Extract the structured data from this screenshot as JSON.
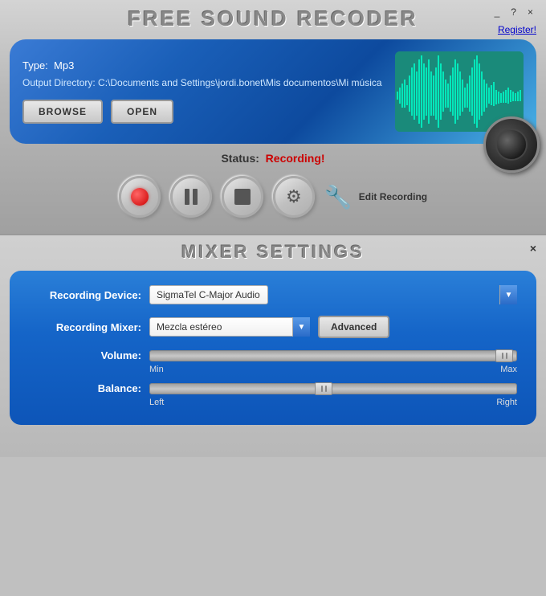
{
  "topWindow": {
    "title": "FREE SOUND RECODER",
    "controls": {
      "minimize": "_",
      "help": "?",
      "close": "×"
    },
    "registerLink": "Register!",
    "infoPanel": {
      "typeLabel": "Type:",
      "typeValue": "Mp3",
      "dirLabel": "Output Directory:",
      "dirValue": "C:\\Documents and Settings\\jordi.bonet\\Mis documentos\\Mi música",
      "browseBtn": "BROWSE",
      "openBtn": "OPEN"
    },
    "status": {
      "label": "Status:",
      "value": "Recording!"
    },
    "controls_row": {
      "editLabel": "Edit Recording"
    }
  },
  "mixerWindow": {
    "title": "MIXER SETTINGS",
    "closeBtn": "×",
    "recordingDeviceLabel": "Recording Device:",
    "recordingDeviceValue": "SigmaTel C-Major Audio",
    "recordingMixerLabel": "Recording Mixer:",
    "recordingMixerValue": "Mezcla estéreo",
    "advancedBtn": "Advanced",
    "volumeLabel": "Volume:",
    "balanceLabel": "Balance:",
    "minLabel": "Min",
    "maxLabel": "Max",
    "leftLabel": "Left",
    "rightLabel": "Right"
  }
}
